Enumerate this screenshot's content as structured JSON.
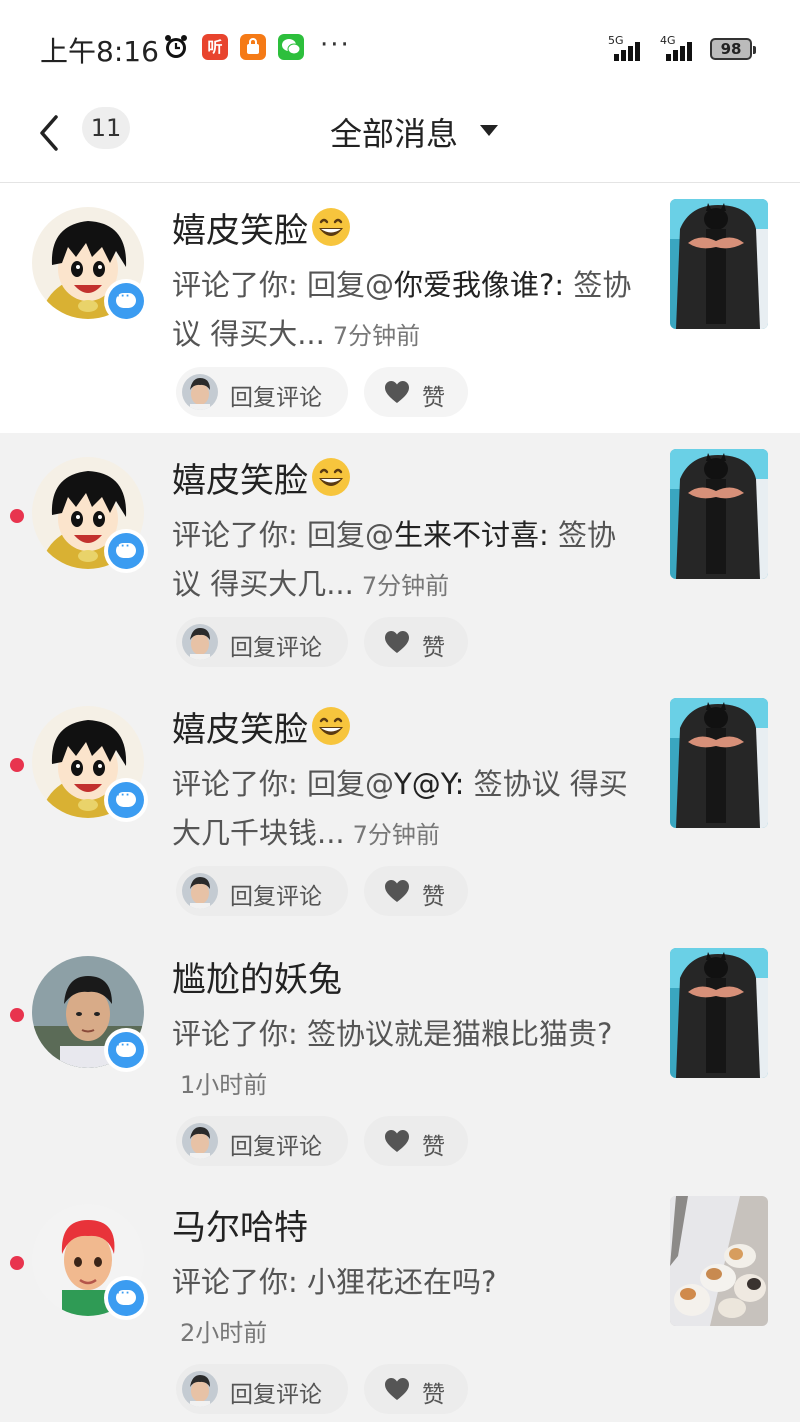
{
  "status_bar": {
    "time": "上午8:16",
    "app_icon_1": "听",
    "more": "···",
    "net_1": "5G",
    "net_2": "4G",
    "battery": "98"
  },
  "header": {
    "back_count": "11",
    "title": "全部消息"
  },
  "actions": {
    "reply_label": "回复评论",
    "like_label": "赞"
  },
  "colors": {
    "unread_dot": "#e8344e",
    "comment_badge": "#3b9cf1"
  },
  "messages": [
    {
      "name": "嬉皮笑脸",
      "name_emoji": "grinning-emoji",
      "avatar": "cartoon-boy-avatar",
      "unread": false,
      "body_prefix": "评论了你: 回复@",
      "body_highlight": "你爱我像谁?:",
      "body_rest": " 签协议  得买大...",
      "time": "7分钟前",
      "thumbnail": "black-cat-photo"
    },
    {
      "name": "嬉皮笑脸",
      "name_emoji": "grinning-emoji",
      "avatar": "cartoon-boy-avatar",
      "unread": true,
      "body_prefix": "评论了你: 回复@",
      "body_highlight": "生来不讨喜:",
      "body_rest": " 签协议  得买大几...",
      "time": "7分钟前",
      "thumbnail": "black-cat-photo"
    },
    {
      "name": "嬉皮笑脸",
      "name_emoji": "grinning-emoji",
      "avatar": "cartoon-boy-avatar",
      "unread": true,
      "body_prefix": "评论了你: 回复@",
      "body_highlight": "Y@Y:",
      "body_rest": " 签协议 得买大几千块钱...",
      "time": "7分钟前",
      "thumbnail": "black-cat-photo"
    },
    {
      "name": "尴尬的妖兔",
      "name_emoji": "",
      "avatar": "young-man-photo-avatar",
      "unread": true,
      "body_prefix": "评论了你: 签协议就是猫粮比猫贵?",
      "body_highlight": "",
      "body_rest": "",
      "time": "1小时前",
      "thumbnail": "black-cat-photo"
    },
    {
      "name": "马尔哈特",
      "name_emoji": "",
      "avatar": "red-hair-3d-avatar",
      "unread": true,
      "body_prefix": "评论了你: 小狸花还在吗?",
      "body_highlight": "",
      "body_rest": "",
      "time": "2小时前",
      "thumbnail": "kittens-photo"
    }
  ]
}
